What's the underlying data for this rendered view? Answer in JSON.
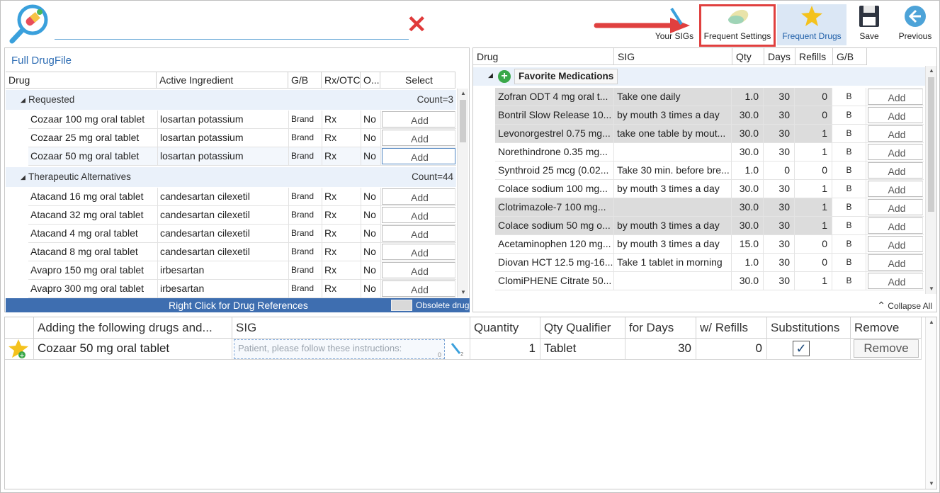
{
  "toolbar": {
    "buttons": {
      "your_sigs": "Your SIGs",
      "frequent_settings": "Frequent Settings",
      "frequent_drugs": "Frequent Drugs",
      "save": "Save",
      "previous": "Previous"
    },
    "active": "frequent_drugs",
    "highlight_color": "#e0403f"
  },
  "left_panel": {
    "title": "Full DrugFile",
    "columns": [
      "Drug",
      "Active Ingredient",
      "G/B",
      "Rx/OTC",
      "O...",
      "Select"
    ],
    "groups": [
      {
        "name": "Requested",
        "count": "Count=3",
        "rows": [
          {
            "drug": "Cozaar 100 mg oral tablet",
            "ingredient": "losartan potassium",
            "gb": "Brand",
            "rx": "Rx",
            "o": "No",
            "select": "Add"
          },
          {
            "drug": "Cozaar 25 mg oral tablet",
            "ingredient": "losartan potassium",
            "gb": "Brand",
            "rx": "Rx",
            "o": "No",
            "select": "Add"
          },
          {
            "drug": "Cozaar 50 mg oral tablet",
            "ingredient": "losartan potassium",
            "gb": "Brand",
            "rx": "Rx",
            "o": "No",
            "select": "Add"
          }
        ]
      },
      {
        "name": "Therapeutic Alternatives",
        "count": "Count=44",
        "rows": [
          {
            "drug": "Atacand 16 mg oral tablet",
            "ingredient": "candesartan cilexetil",
            "gb": "Brand",
            "rx": "Rx",
            "o": "No",
            "select": "Add"
          },
          {
            "drug": "Atacand 32 mg oral tablet",
            "ingredient": "candesartan cilexetil",
            "gb": "Brand",
            "rx": "Rx",
            "o": "No",
            "select": "Add"
          },
          {
            "drug": "Atacand 4 mg oral tablet",
            "ingredient": "candesartan cilexetil",
            "gb": "Brand",
            "rx": "Rx",
            "o": "No",
            "select": "Add"
          },
          {
            "drug": "Atacand 8 mg oral tablet",
            "ingredient": "candesartan cilexetil",
            "gb": "Brand",
            "rx": "Rx",
            "o": "No",
            "select": "Add"
          },
          {
            "drug": "Avapro 150 mg oral tablet",
            "ingredient": "irbesartan",
            "gb": "Brand",
            "rx": "Rx",
            "o": "No",
            "select": "Add"
          },
          {
            "drug": "Avapro 300 mg oral tablet",
            "ingredient": "irbesartan",
            "gb": "Brand",
            "rx": "Rx",
            "o": "No",
            "select": "Add"
          }
        ]
      }
    ],
    "footer": "Right Click for Drug References",
    "obsolete_label": "Obsolete drug"
  },
  "right_panel": {
    "columns": [
      "Drug",
      "SIG",
      "Qty",
      "Days",
      "Refills",
      "G/B"
    ],
    "group_name": "Favorite Medications",
    "rows": [
      {
        "drug": "Zofran ODT 4 mg oral t...",
        "sig": "Take one daily",
        "qty": "1.0",
        "days": "30",
        "refills": "0",
        "gb": "B",
        "action": "Add",
        "highlighted": true
      },
      {
        "drug": "Bontril Slow Release 10...",
        "sig": "by mouth 3 times a day",
        "qty": "30.0",
        "days": "30",
        "refills": "0",
        "gb": "B",
        "action": "Add",
        "highlighted": true
      },
      {
        "drug": "Levonorgestrel 0.75 mg...",
        "sig": "take one table by mout...",
        "qty": "30.0",
        "days": "30",
        "refills": "1",
        "gb": "B",
        "action": "Add",
        "highlighted": true
      },
      {
        "drug": "Norethindrone 0.35 mg...",
        "sig": "",
        "qty": "30.0",
        "days": "30",
        "refills": "1",
        "gb": "B",
        "action": "Add",
        "highlighted": false
      },
      {
        "drug": "Synthroid 25 mcg (0.02...",
        "sig": "Take 30 min. before bre...",
        "qty": "1.0",
        "days": "0",
        "refills": "0",
        "gb": "B",
        "action": "Add",
        "highlighted": false
      },
      {
        "drug": "Colace sodium 100 mg...",
        "sig": "by mouth 3 times a day",
        "qty": "30.0",
        "days": "30",
        "refills": "1",
        "gb": "B",
        "action": "Add",
        "highlighted": false
      },
      {
        "drug": "Clotrimazole-7 100 mg...",
        "sig": "",
        "qty": "30.0",
        "days": "30",
        "refills": "1",
        "gb": "B",
        "action": "Add",
        "highlighted": true
      },
      {
        "drug": "Colace sodium 50 mg o...",
        "sig": "by mouth 3 times a day",
        "qty": "30.0",
        "days": "30",
        "refills": "1",
        "gb": "B",
        "action": "Add",
        "highlighted": true
      },
      {
        "drug": "Acetaminophen 120 mg...",
        "sig": "by mouth 3 times a day",
        "qty": "15.0",
        "days": "30",
        "refills": "0",
        "gb": "B",
        "action": "Add",
        "highlighted": false
      },
      {
        "drug": "Diovan HCT 12.5 mg-16...",
        "sig": "Take 1 tablet in morning",
        "qty": "1.0",
        "days": "30",
        "refills": "0",
        "gb": "B",
        "action": "Add",
        "highlighted": false
      },
      {
        "drug": "ClomiPHENE Citrate 50...",
        "sig": "",
        "qty": "30.0",
        "days": "30",
        "refills": "1",
        "gb": "B",
        "action": "Add",
        "highlighted": false
      }
    ],
    "collapse_all": "Collapse All"
  },
  "bottom": {
    "columns": [
      "Adding the following drugs and...",
      "SIG",
      "Quantity",
      "Qty Qualifier",
      "for Days",
      "w/ Refills",
      "Substitutions",
      "Remove"
    ],
    "row": {
      "drug": "Cozaar 50 mg oral tablet",
      "sig_placeholder": "Patient, please follow these instructions:",
      "sig_count": "0",
      "quantity": "1",
      "qualifier": "Tablet",
      "days": "30",
      "refills": "0",
      "substitutions_checked": true,
      "remove": "Remove"
    }
  }
}
